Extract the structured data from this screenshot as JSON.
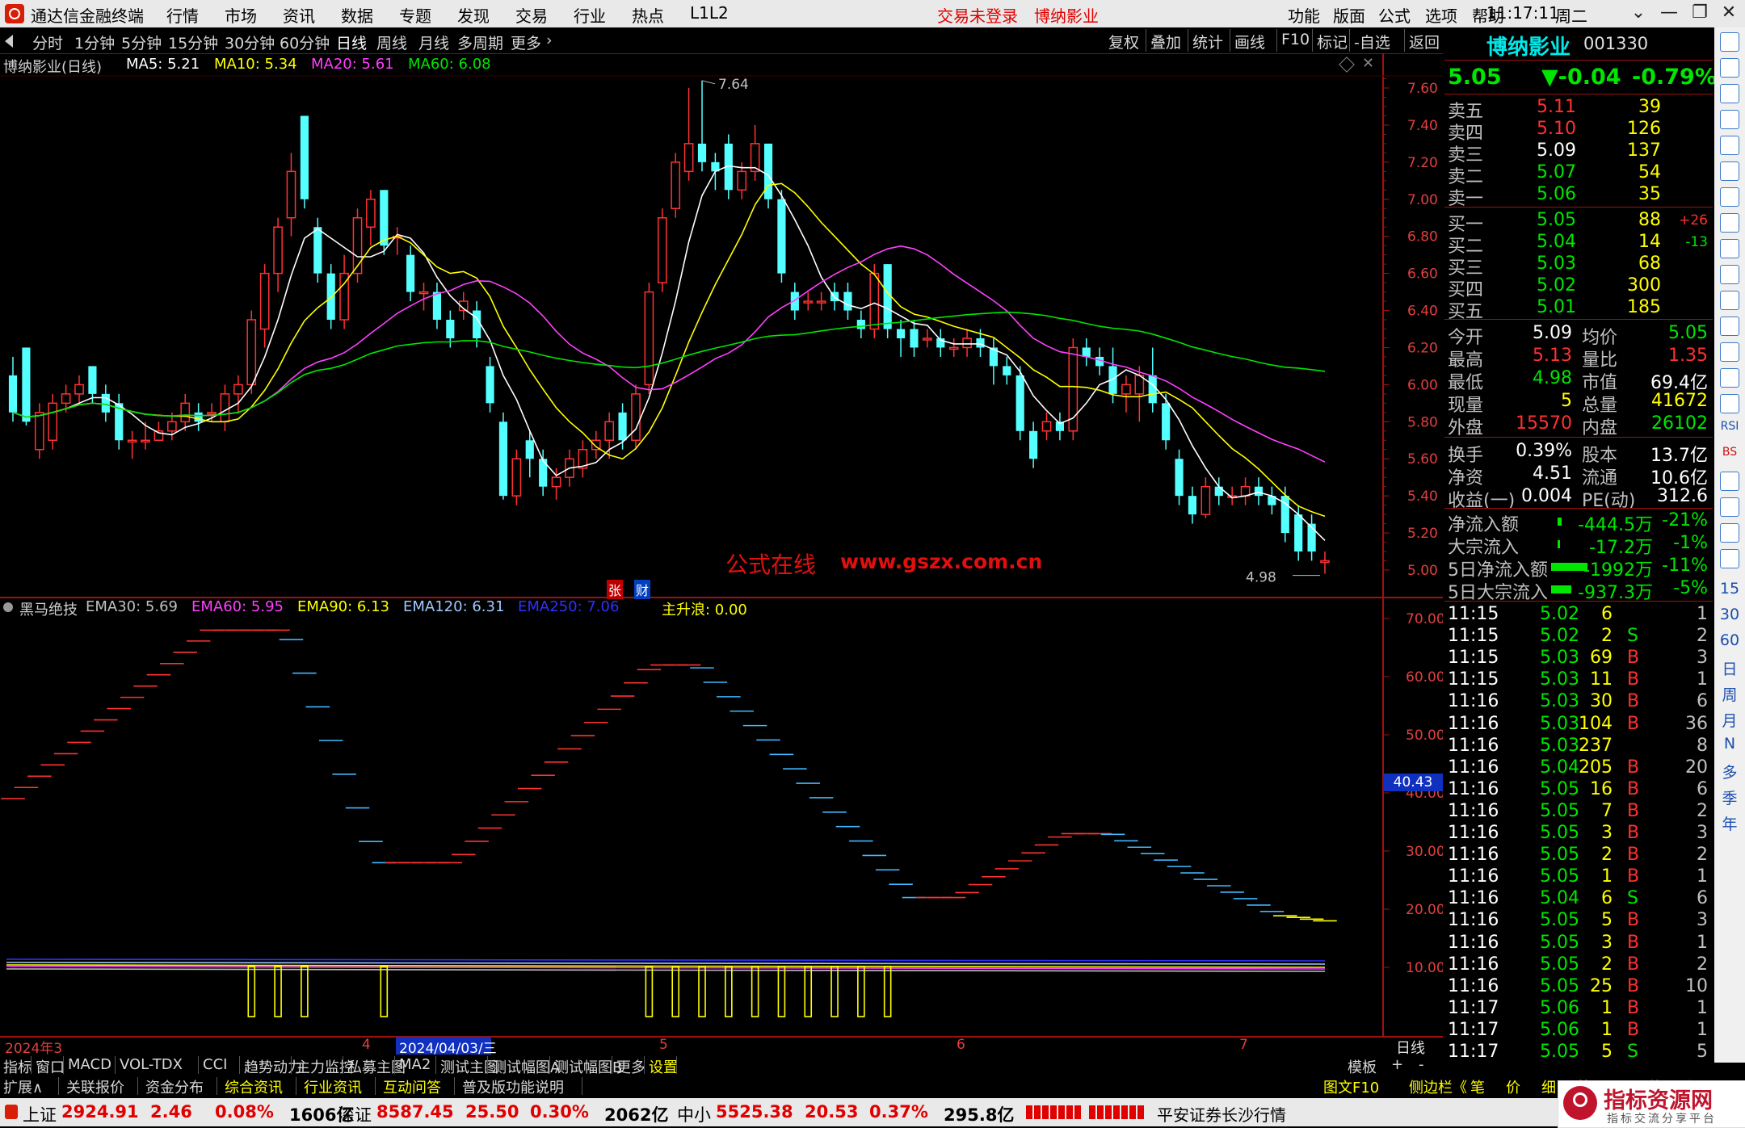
{
  "titlebar": {
    "app_name": "通达信金融终端",
    "menus": [
      "行情",
      "市场",
      "资讯",
      "数据",
      "专题",
      "发现",
      "交易",
      "行业",
      "热点",
      "L1L2"
    ],
    "notice_login": "交易未登录",
    "notice_stock": "博纳影业",
    "right_menus": [
      "功能",
      "版面",
      "公式",
      "选项",
      "帮助"
    ],
    "time": "11:17:11",
    "weekday": "周二"
  },
  "periodbar": {
    "periods": [
      "分时",
      "1分钟",
      "5分钟",
      "15分钟",
      "30分钟",
      "60分钟",
      "日线",
      "周线",
      "月线",
      "多周期",
      "更多"
    ],
    "selected": "日线",
    "tools": [
      "复权",
      "叠加",
      "统计",
      "画线",
      "F10",
      "标记",
      "-自选",
      "返回"
    ]
  },
  "chart_header": {
    "name": "博纳影业(日线)",
    "ma": [
      {
        "label": "MA5: 5.21",
        "color": "#ffffff"
      },
      {
        "label": "MA10: 5.34",
        "color": "#ffff00"
      },
      {
        "label": "MA20: 5.61",
        "color": "#ff40ff"
      },
      {
        "label": "MA60: 6.08",
        "color": "#00e600"
      }
    ],
    "high_label": "7.64",
    "low_label": "4.98",
    "watermark": "公式在线",
    "watermark_url": "www.gszx.com.cn",
    "tag_zhang": "张",
    "tag_cai": "财"
  },
  "indicator_header": {
    "name": "黑马绝技",
    "items": [
      {
        "label": "EMA30: 5.69",
        "color": "#c0c0c0"
      },
      {
        "label": "EMA60: 5.95",
        "color": "#ff40ff"
      },
      {
        "label": "EMA90: 6.13",
        "color": "#ffff00"
      },
      {
        "label": "EMA120: 6.31",
        "color": "#a0c8ff"
      },
      {
        "label": "EMA250: 7.06",
        "color": "#3030ff"
      },
      {
        "label": "主升浪: 0.00",
        "color": "#ffff00"
      }
    ],
    "current_value": "40.43"
  },
  "price_axis": [
    "7.60",
    "7.40",
    "7.20",
    "7.00",
    "6.80",
    "6.60",
    "6.40",
    "6.20",
    "6.00",
    "5.80",
    "5.60",
    "5.40",
    "5.20",
    "5.00"
  ],
  "ind_axis": [
    "70.00",
    "60.00",
    "50.00",
    "40.00",
    "30.00",
    "20.00",
    "10.00"
  ],
  "date_axis": {
    "labels": [
      "2024年3",
      "4",
      "2024/04/03/三",
      "5",
      "6",
      "7"
    ],
    "right_label": "日线"
  },
  "chart_data": {
    "type": "candlestick",
    "ma_labels": [
      "MA5",
      "MA10",
      "MA20",
      "MA60"
    ],
    "price_range": [
      4.9,
      7.7
    ],
    "candles": [
      [
        6.05,
        5.85,
        6.15,
        5.8
      ],
      [
        6.2,
        5.8,
        6.2,
        5.78
      ],
      [
        5.65,
        5.85,
        5.9,
        5.6
      ],
      [
        5.7,
        5.9,
        5.95,
        5.65
      ],
      [
        5.9,
        5.95,
        6.0,
        5.85
      ],
      [
        5.95,
        6.0,
        6.05,
        5.9
      ],
      [
        6.1,
        5.95,
        6.1,
        5.9
      ],
      [
        5.95,
        5.85,
        6.0,
        5.8
      ],
      [
        5.9,
        5.7,
        5.95,
        5.65
      ],
      [
        5.7,
        5.7,
        5.75,
        5.6
      ],
      [
        5.7,
        5.7,
        5.8,
        5.65
      ],
      [
        5.7,
        5.75,
        5.8,
        5.7
      ],
      [
        5.75,
        5.8,
        5.85,
        5.7
      ],
      [
        5.8,
        5.9,
        5.95,
        5.75
      ],
      [
        5.85,
        5.8,
        5.9,
        5.75
      ],
      [
        5.85,
        5.85,
        5.9,
        5.8
      ],
      [
        5.8,
        5.95,
        6.0,
        5.75
      ],
      [
        5.95,
        6.0,
        6.05,
        5.85
      ],
      [
        6.0,
        6.35,
        6.4,
        5.95
      ],
      [
        6.3,
        6.6,
        6.65,
        6.2
      ],
      [
        6.6,
        6.85,
        6.9,
        6.5
      ],
      [
        6.9,
        7.15,
        7.25,
        6.8
      ],
      [
        7.45,
        7.0,
        7.45,
        6.95
      ],
      [
        6.85,
        6.6,
        6.9,
        6.55
      ],
      [
        6.6,
        6.35,
        6.65,
        6.3
      ],
      [
        6.35,
        6.6,
        6.7,
        6.3
      ],
      [
        6.6,
        6.9,
        6.95,
        6.55
      ],
      [
        6.85,
        7.0,
        7.05,
        6.75
      ],
      [
        7.05,
        6.75,
        7.05,
        6.7
      ],
      [
        6.8,
        6.8,
        6.85,
        6.7
      ],
      [
        6.7,
        6.5,
        6.75,
        6.45
      ],
      [
        6.5,
        6.5,
        6.55,
        6.4
      ],
      [
        6.5,
        6.35,
        6.55,
        6.3
      ],
      [
        6.35,
        6.25,
        6.4,
        6.2
      ],
      [
        6.4,
        6.45,
        6.5,
        6.35
      ],
      [
        6.4,
        6.25,
        6.45,
        6.2
      ],
      [
        6.1,
        5.9,
        6.15,
        5.85
      ],
      [
        5.8,
        5.4,
        5.85,
        5.38
      ],
      [
        5.4,
        5.6,
        5.65,
        5.35
      ],
      [
        5.7,
        5.6,
        5.75,
        5.5
      ],
      [
        5.6,
        5.45,
        5.65,
        5.4
      ],
      [
        5.45,
        5.5,
        5.55,
        5.38
      ],
      [
        5.5,
        5.6,
        5.65,
        5.45
      ],
      [
        5.55,
        5.65,
        5.7,
        5.5
      ],
      [
        5.65,
        5.7,
        5.75,
        5.6
      ],
      [
        5.7,
        5.8,
        5.85,
        5.6
      ],
      [
        5.85,
        5.7,
        5.9,
        5.65
      ],
      [
        5.7,
        5.95,
        6.0,
        5.65
      ],
      [
        6.0,
        6.5,
        6.55,
        5.95
      ],
      [
        6.55,
        6.9,
        6.95,
        6.5
      ],
      [
        6.95,
        7.2,
        7.25,
        6.9
      ],
      [
        7.15,
        7.3,
        7.6,
        7.1
      ],
      [
        7.3,
        7.2,
        7.64,
        7.15
      ],
      [
        7.2,
        7.15,
        7.25,
        7.05
      ],
      [
        7.3,
        7.05,
        7.35,
        7.0
      ],
      [
        7.05,
        7.15,
        7.2,
        7.0
      ],
      [
        7.15,
        7.3,
        7.4,
        7.1
      ],
      [
        7.3,
        7.0,
        7.3,
        6.95
      ],
      [
        7.0,
        6.6,
        7.05,
        6.55
      ],
      [
        6.5,
        6.4,
        6.55,
        6.35
      ],
      [
        6.45,
        6.45,
        6.5,
        6.4
      ],
      [
        6.45,
        6.45,
        6.5,
        6.4
      ],
      [
        6.5,
        6.45,
        6.55,
        6.4
      ],
      [
        6.5,
        6.4,
        6.55,
        6.35
      ],
      [
        6.35,
        6.3,
        6.4,
        6.25
      ],
      [
        6.3,
        6.6,
        6.65,
        6.25
      ],
      [
        6.65,
        6.3,
        6.65,
        6.25
      ],
      [
        6.3,
        6.25,
        6.35,
        6.15
      ],
      [
        6.3,
        6.2,
        6.35,
        6.15
      ],
      [
        6.25,
        6.25,
        6.3,
        6.2
      ],
      [
        6.25,
        6.2,
        6.3,
        6.15
      ],
      [
        6.2,
        6.2,
        6.25,
        6.15
      ],
      [
        6.2,
        6.25,
        6.3,
        6.15
      ],
      [
        6.25,
        6.2,
        6.3,
        6.15
      ],
      [
        6.2,
        6.1,
        6.25,
        6.0
      ],
      [
        6.1,
        6.05,
        6.15,
        6.0
      ],
      [
        6.05,
        5.75,
        6.1,
        5.7
      ],
      [
        5.75,
        5.6,
        5.8,
        5.55
      ],
      [
        5.75,
        5.8,
        5.85,
        5.7
      ],
      [
        5.8,
        5.75,
        5.85,
        5.7
      ],
      [
        5.75,
        6.2,
        6.25,
        5.7
      ],
      [
        6.2,
        6.15,
        6.25,
        6.1
      ],
      [
        6.15,
        6.1,
        6.2,
        6.05
      ],
      [
        6.1,
        5.95,
        6.2,
        5.9
      ],
      [
        5.95,
        6.0,
        6.05,
        5.85
      ],
      [
        5.95,
        6.05,
        6.1,
        5.8
      ],
      [
        6.05,
        5.9,
        6.2,
        5.85
      ],
      [
        5.9,
        5.7,
        5.95,
        5.65
      ],
      [
        5.6,
        5.4,
        5.65,
        5.35
      ],
      [
        5.4,
        5.3,
        5.45,
        5.25
      ],
      [
        5.3,
        5.45,
        5.5,
        5.28
      ],
      [
        5.45,
        5.4,
        5.5,
        5.35
      ],
      [
        5.4,
        5.4,
        5.45,
        5.35
      ],
      [
        5.4,
        5.45,
        5.5,
        5.35
      ],
      [
        5.45,
        5.4,
        5.5,
        5.35
      ],
      [
        5.4,
        5.35,
        5.45,
        5.3
      ],
      [
        5.4,
        5.2,
        5.45,
        5.15
      ],
      [
        5.3,
        5.1,
        5.35,
        5.05
      ],
      [
        5.25,
        5.1,
        5.3,
        5.05
      ],
      [
        5.05,
        5.05,
        5.1,
        4.98
      ]
    ]
  },
  "right_panel": {
    "stock_name": "博纳影业",
    "stock_code": "001330",
    "price": "5.05",
    "change": "▼-0.04",
    "change_pct": "-0.79%",
    "asks": [
      {
        "label": "卖五",
        "price": "5.11",
        "vol": "39",
        "pc": "rd"
      },
      {
        "label": "卖四",
        "price": "5.10",
        "vol": "126",
        "pc": "rd"
      },
      {
        "label": "卖三",
        "price": "5.09",
        "vol": "137",
        "pc": "wht"
      },
      {
        "label": "卖二",
        "price": "5.07",
        "vol": "54",
        "pc": "grn"
      },
      {
        "label": "卖一",
        "price": "5.06",
        "vol": "35",
        "pc": "grn"
      }
    ],
    "bids": [
      {
        "label": "买一",
        "price": "5.05",
        "vol": "88",
        "chg": "+26",
        "chgc": "rd"
      },
      {
        "label": "买二",
        "price": "5.04",
        "vol": "14",
        "chg": "-13",
        "chgc": "grn"
      },
      {
        "label": "买三",
        "price": "5.03",
        "vol": "68",
        "chg": "",
        "chgc": "grn"
      },
      {
        "label": "买四",
        "price": "5.02",
        "vol": "300",
        "chg": "",
        "chgc": "grn"
      },
      {
        "label": "买五",
        "price": "5.01",
        "vol": "185",
        "chg": "",
        "chgc": "grn"
      }
    ],
    "stats": [
      {
        "l1": "今开",
        "v1": "5.09",
        "c1": "wht",
        "l2": "均价",
        "v2": "5.05",
        "c2": "grn"
      },
      {
        "l1": "最高",
        "v1": "5.13",
        "c1": "rd",
        "l2": "量比",
        "v2": "1.35",
        "c2": "rd"
      },
      {
        "l1": "最低",
        "v1": "4.98",
        "c1": "grn",
        "l2": "市值",
        "v2": "69.4亿",
        "c2": "wht"
      },
      {
        "l1": "现量",
        "v1": "5",
        "c1": "yel",
        "l2": "总量",
        "v2": "41672",
        "c2": "yel"
      },
      {
        "l1": "外盘",
        "v1": "15570",
        "c1": "rd",
        "l2": "内盘",
        "v2": "26102",
        "c2": "grn"
      }
    ],
    "stats2": [
      {
        "l1": "换手",
        "v1": "0.39%",
        "c1": "wht",
        "l2": "股本",
        "v2": "13.7亿",
        "c2": "wht"
      },
      {
        "l1": "净资",
        "v1": "4.51",
        "c1": "wht",
        "l2": "流通",
        "v2": "10.6亿",
        "c2": "wht"
      },
      {
        "l1": "收益(一)",
        "v1": "0.004",
        "c1": "wht",
        "l2": "PE(动)",
        "v2": "312.6",
        "c2": "wht"
      }
    ],
    "flows": [
      {
        "label": "净流入额",
        "val": "-444.5万",
        "pct": "-21%",
        "bar": 0.06
      },
      {
        "label": "大宗流入",
        "val": "-17.2万",
        "pct": "-1%",
        "bar": 0.01
      },
      {
        "label": "5日净流入额",
        "val": "-1992万",
        "pct": "-11%",
        "bar": 0.5
      },
      {
        "label": "5日大宗流入",
        "val": "-937.3万",
        "pct": "-5%",
        "bar": 0.28
      }
    ],
    "ticks": [
      [
        "11:15",
        "5.02",
        "6",
        "",
        "1",
        "grn"
      ],
      [
        "11:15",
        "5.02",
        "2",
        "S",
        "2",
        "grn"
      ],
      [
        "11:15",
        "5.03",
        "69",
        "B",
        "3",
        "grn"
      ],
      [
        "11:15",
        "5.03",
        "11",
        "B",
        "1",
        "grn"
      ],
      [
        "11:16",
        "5.03",
        "30",
        "B",
        "6",
        "grn"
      ],
      [
        "11:16",
        "5.03",
        "104",
        "B",
        "36",
        "grn"
      ],
      [
        "11:16",
        "5.03",
        "237",
        "",
        "8",
        "grn"
      ],
      [
        "11:16",
        "5.04",
        "205",
        "B",
        "20",
        "grn"
      ],
      [
        "11:16",
        "5.05",
        "16",
        "B",
        "6",
        "grn"
      ],
      [
        "11:16",
        "5.05",
        "7",
        "B",
        "2",
        "grn"
      ],
      [
        "11:16",
        "5.05",
        "3",
        "B",
        "3",
        "grn"
      ],
      [
        "11:16",
        "5.05",
        "2",
        "B",
        "2",
        "grn"
      ],
      [
        "11:16",
        "5.05",
        "1",
        "B",
        "1",
        "grn"
      ],
      [
        "11:16",
        "5.04",
        "6",
        "S",
        "6",
        "grn"
      ],
      [
        "11:16",
        "5.05",
        "5",
        "B",
        "3",
        "grn"
      ],
      [
        "11:16",
        "5.05",
        "3",
        "B",
        "1",
        "grn"
      ],
      [
        "11:16",
        "5.05",
        "2",
        "B",
        "2",
        "grn"
      ],
      [
        "11:16",
        "5.05",
        "25",
        "B",
        "10",
        "grn"
      ],
      [
        "11:17",
        "5.06",
        "1",
        "B",
        "1",
        "grn"
      ],
      [
        "11:17",
        "5.06",
        "1",
        "B",
        "1",
        "grn"
      ],
      [
        "11:17",
        "5.05",
        "5",
        "S",
        "5",
        "grn"
      ]
    ]
  },
  "sidebar": {
    "text_items": [
      "RSI",
      "BS",
      "15",
      "30",
      "60",
      "日",
      "周",
      "月",
      "N",
      "多",
      "季",
      "年"
    ]
  },
  "tabs1": [
    "指标",
    "窗口",
    "MACD",
    "VOL-TDX",
    "CCI",
    "趋势动力",
    "主力监控",
    "私募主图",
    "MA2",
    "测试主图",
    "测试幅图A",
    "测试幅图B",
    "更多",
    "设置"
  ],
  "tabs1_right": [
    "模板",
    "+",
    "-"
  ],
  "tabs2": [
    "扩展∧",
    "关联报价",
    "资金分布",
    "综合资讯",
    "行业资讯",
    "互动问答",
    "普及版功能说明"
  ],
  "tabs2_right": [
    "图文F10",
    "侧边栏《",
    "笔",
    "价",
    "细",
    "势",
    "联",
    "值",
    "主"
  ],
  "statusbar": {
    "items": [
      {
        "name": "上证",
        "price": "2924.91",
        "chg": "2.46",
        "pct": "0.08%",
        "amt": "1606亿"
      },
      {
        "name": "深证",
        "price": "8587.45",
        "chg": "25.50",
        "pct": "0.30%",
        "amt": "2062亿"
      },
      {
        "name": "中小",
        "price": "5525.38",
        "chg": "20.53",
        "pct": "0.37%",
        "amt": "295.8亿"
      }
    ],
    "broker": "平安证券长沙行情",
    "brand": "指标资源网",
    "brand_sub": "指标交流分享平台"
  }
}
